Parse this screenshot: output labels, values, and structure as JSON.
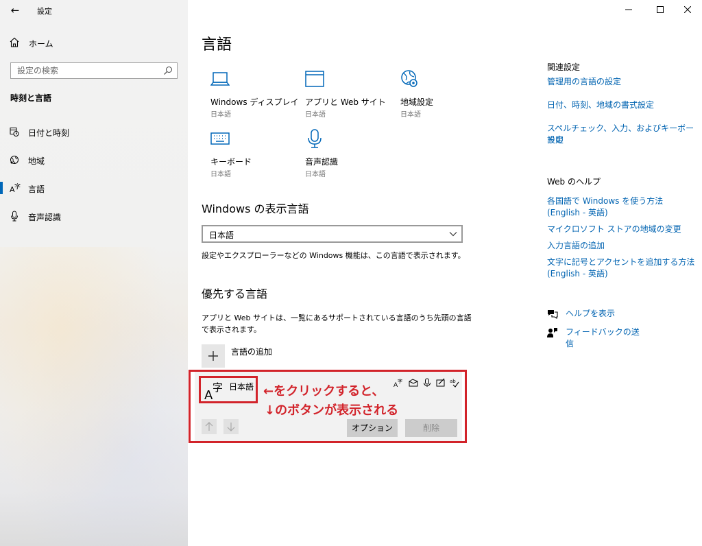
{
  "window": {
    "title": "設定",
    "minimize": "—",
    "maximize": "☐",
    "close": "✕"
  },
  "sidebar": {
    "home_label": "ホーム",
    "search_placeholder": "設定の検索",
    "section_title": "時刻と言語",
    "items": [
      {
        "label": "日付と時刻",
        "icon": "calendar-clock-icon"
      },
      {
        "label": "地域",
        "icon": "globe-icon"
      },
      {
        "label": "言語",
        "icon": "language-icon",
        "active": true
      },
      {
        "label": "音声認識",
        "icon": "microphone-icon"
      }
    ]
  },
  "main": {
    "title": "言語",
    "tiles": [
      {
        "title": "Windows ディスプレイ",
        "sub": "日本語",
        "icon": "laptop-icon"
      },
      {
        "title": "アプリと Web サイト",
        "sub": "日本語",
        "icon": "window-icon"
      },
      {
        "title": "地域設定",
        "sub": "日本語",
        "icon": "globe-settings-icon"
      },
      {
        "title": "キーボード",
        "sub": "日本語",
        "icon": "keyboard-icon"
      },
      {
        "title": "音声認識",
        "sub": "日本語",
        "icon": "microphone-icon"
      }
    ],
    "display_lang_heading": "Windows の表示言語",
    "display_lang_value": "日本語",
    "display_lang_desc": "設定やエクスプローラーなどの Windows 機能は、この言語で表示されます。",
    "preferred_heading": "優先する言語",
    "preferred_desc_1": "アプリと Web サイトは、一覧にあるサポートされている言語のうち先頭の言語",
    "preferred_desc_2": "で表示されます。",
    "add_language": "言語の追加",
    "language_card": {
      "name": "日本語",
      "glyph_latin": "A",
      "glyph_kanji": "字",
      "options_label": "オプション",
      "remove_label": "削除"
    },
    "annotation_1": "←をクリックすると、",
    "annotation_2": "↓のボタンが表示される",
    "annotation_color": "#d2232a"
  },
  "right": {
    "related_heading": "関連設定",
    "related_links": [
      "管理用の言語の設定",
      "日付、時刻、地域の書式設定",
      "スペルチェック、入力、およびキーボードの",
      "設定"
    ],
    "help_heading": "Web のヘルプ",
    "help_links": [
      "各国語で Windows を使う方法",
      "(English - 英語)",
      "マイクロソフト ストアの地域の変更",
      "入力言語の追加",
      "文字に記号とアクセントを追加する方法",
      "(English - 英語)"
    ],
    "get_help": "ヘルプを表示",
    "feedback": "フィードバックの送信"
  },
  "colors": {
    "accent": "#0067b8",
    "link": "#0063b1",
    "sidebar_bg": "#f2f2f2"
  }
}
